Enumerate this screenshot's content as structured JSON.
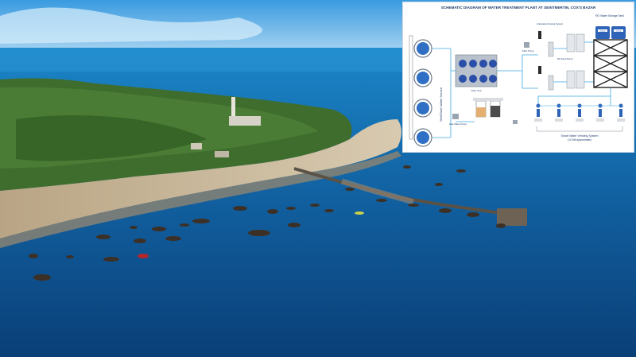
{
  "photo": {
    "subject": "aerial-view-of-island-coast-with-boats-and-jetty",
    "colors": {
      "sky": "#2f8fd6",
      "sea_far": "#1a7fc2",
      "sea_near": "#0b4a86",
      "forest": "#3d6b2c",
      "beach": "#c9b79a"
    }
  },
  "diagram": {
    "title": "SCHEMATIC DIAGRAM OF WATER TREATMENT PLANT AT SEINTMERTIN, COX'S BAZAR",
    "source_label": "Well/Tube Water Source",
    "filter_unit_label": "Filter Unit",
    "pump_labels": [
      "Raw Water Pump",
      "Filter Pump",
      "RO Feed Pump",
      "Antiscalent Dosing System"
    ],
    "storage_tank_label": "RO Water Storage Tank",
    "tank_badges": [
      "10000L",
      "10000L"
    ],
    "vending_label": "Smart Water Vending System",
    "vending_sublabel": "(10 Set approximate)",
    "colors": {
      "pipe": "#3fa9e0",
      "circle": "#2f6fc4",
      "tank": "#2e63b8",
      "frame": "#222222"
    }
  }
}
